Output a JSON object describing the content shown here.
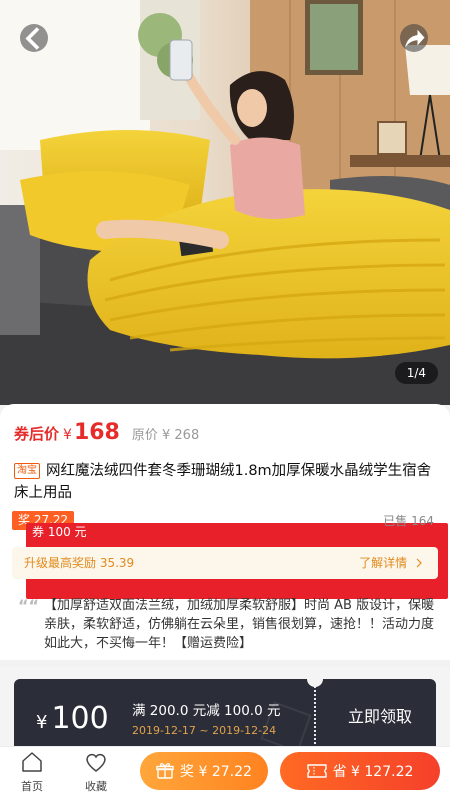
{
  "gallery": {
    "counter": "1/4"
  },
  "product": {
    "price_label": "券后价",
    "currency": "¥",
    "price": "168",
    "original_price": "原价 ¥ 268",
    "platform_tag": "淘宝",
    "title": "网红魔法绒四件套冬季珊瑚绒1.8m加厚保暖水晶绒学生宿舍床上用品",
    "coupon_chip": "券 100 元",
    "reward_chip": "奖 27.22",
    "sold": "已售 164",
    "upgrade_text": "升级最高奖励 35.39",
    "upgrade_link": "了解详情",
    "quote_mark": "““",
    "description": "【加厚舒适双面法兰绒，加绒加厚柔软舒服】时尚 AB 版设计，保暖亲肤，柔软舒适，仿佛躺在云朵里，销售很划算，速抢！！活动力度如此大，不买悔一年！【赠运费险】"
  },
  "coupon": {
    "currency": "¥",
    "amount": "100",
    "condition": "满 200.0 元减 100.0 元",
    "validity": "2019-12-17 ~ 2019-12-24",
    "claim_label": "立即领取"
  },
  "bottom_bar": {
    "home_label": "首页",
    "favorite_label": "收藏",
    "reward_button": "奖 ¥ 27.22",
    "save_button": "省 ¥ 127.22"
  },
  "colors": {
    "price_red": "#e62b2b",
    "coupon_bg": "#2b2e38",
    "accent_orange": "#ff8320",
    "save_red": "#f5402a"
  },
  "icons": [
    "back-arrow-icon",
    "share-icon",
    "home-icon",
    "heart-icon",
    "gift-icon",
    "ticket-icon"
  ]
}
